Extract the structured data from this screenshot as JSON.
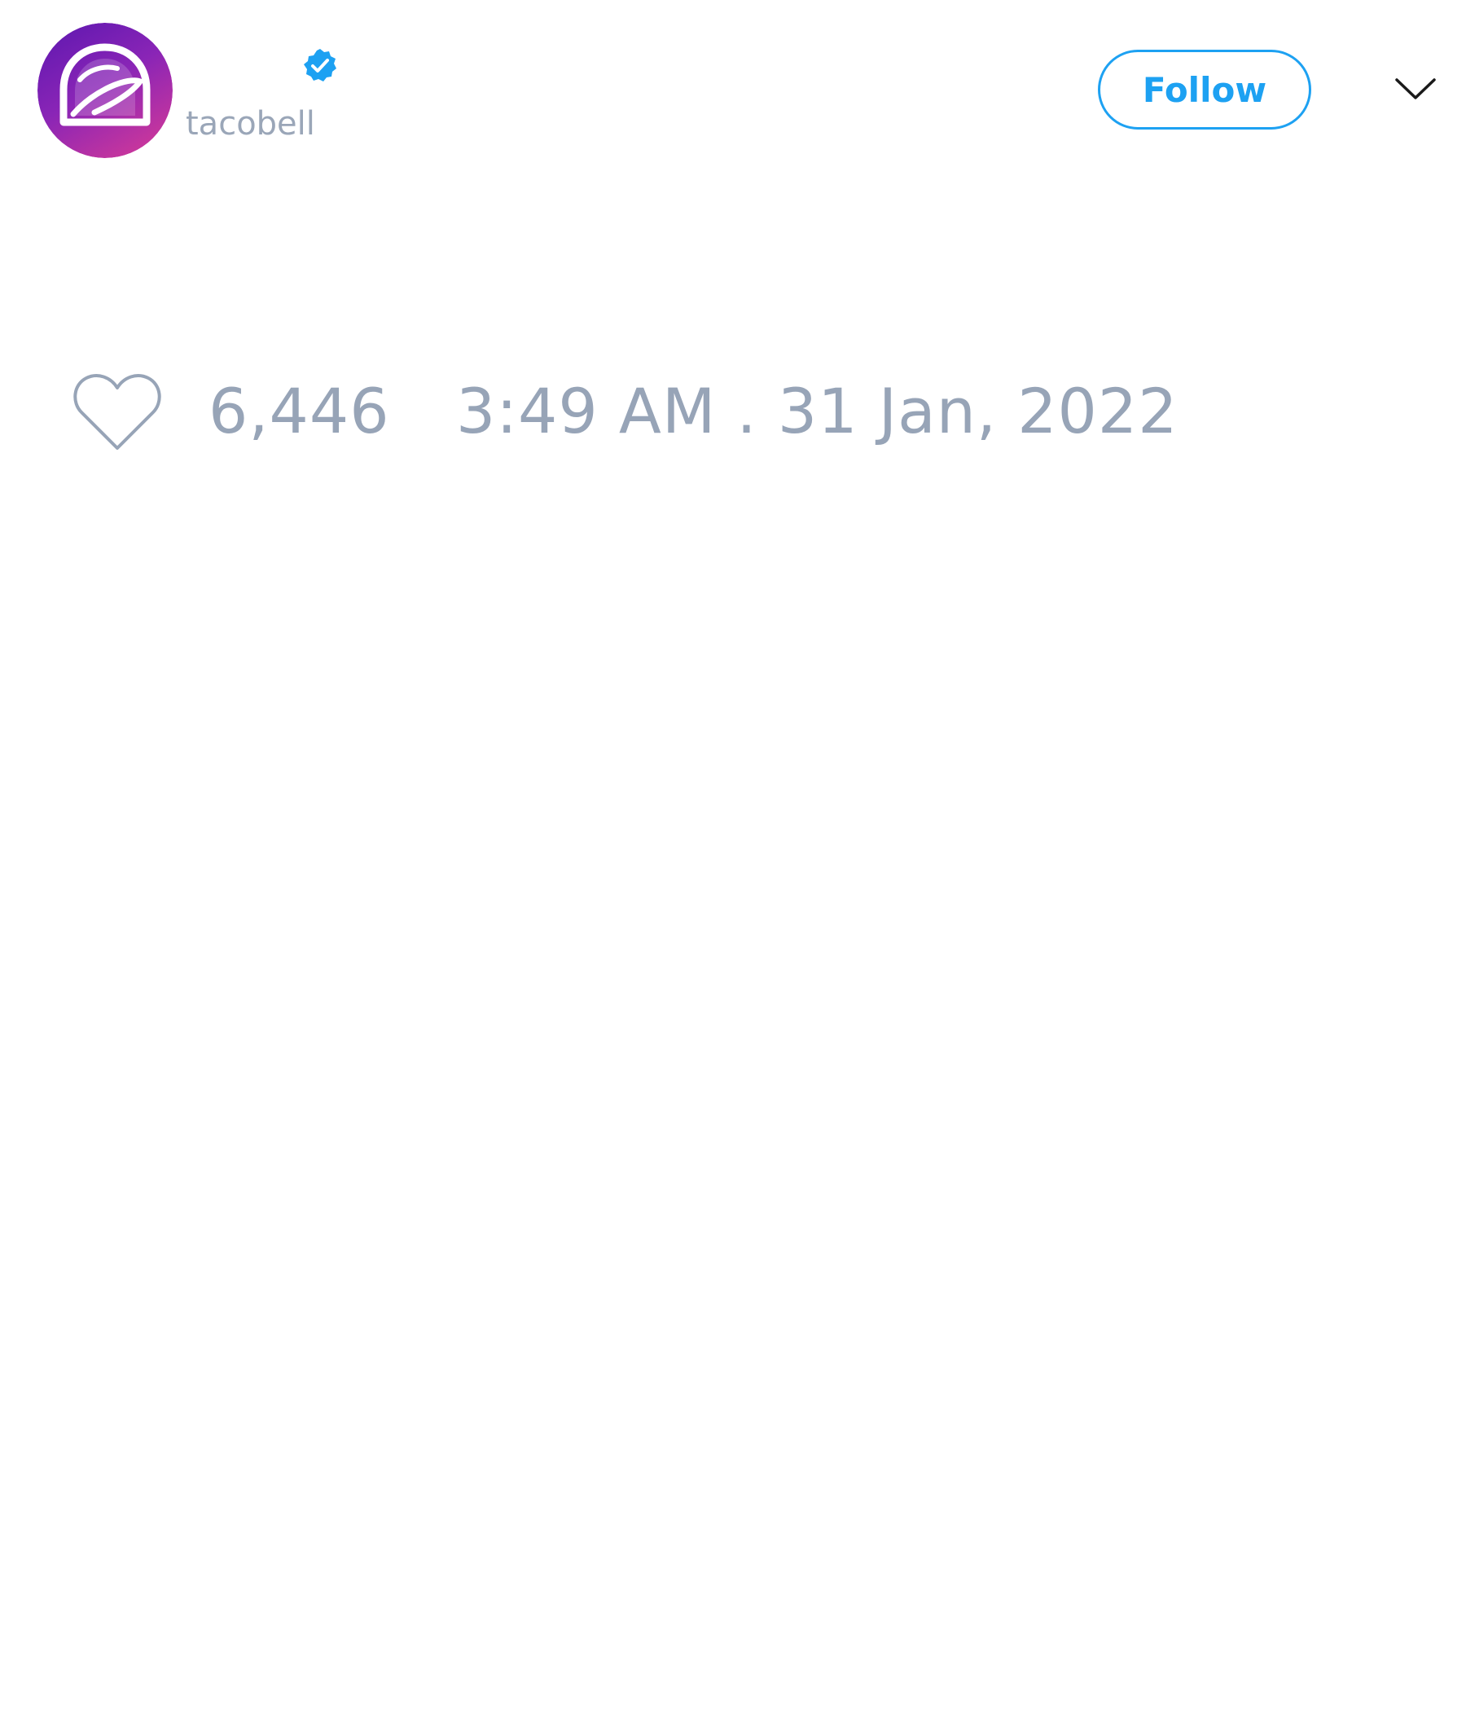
{
  "tweet": {
    "author": {
      "display_name": "",
      "handle": "tacobell",
      "verified": true,
      "avatar_icon": "taco-bell-logo",
      "avatar_colors": [
        "#6a1bb4",
        "#b02ea8"
      ]
    },
    "follow_label": "Follow",
    "menu_icon": "chevron-down-icon",
    "like_icon": "heart-icon",
    "like_count": "6,446",
    "timestamp": "3:49 AM . 31 Jan, 2022"
  },
  "colors": {
    "accent": "#1da1f2",
    "muted_text": "#97a4b7",
    "background": "#ffffff"
  }
}
